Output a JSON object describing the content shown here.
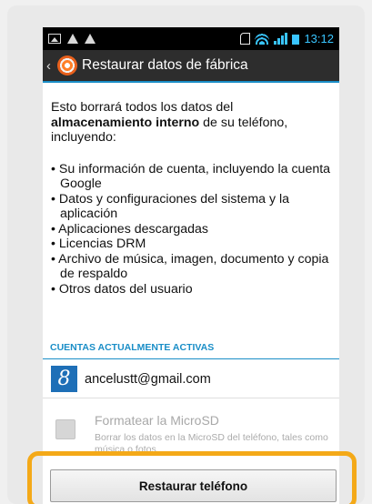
{
  "status_bar": {
    "time": "13:12"
  },
  "action_bar": {
    "title": "Restaurar datos de fábrica"
  },
  "warning": {
    "intro_prefix": "Esto borrará todos los datos del ",
    "intro_bold": "almacenamiento interno",
    "intro_suffix": " de su teléfono, incluyendo:",
    "items": [
      "Su información de cuenta, incluyendo la cuenta Google",
      "Datos y configuraciones del sistema y la aplicación",
      "Aplicaciones descargadas",
      "Licencias DRM",
      "Archivo de música, imagen, documento y copia de respaldo",
      "Otros datos del usuario"
    ]
  },
  "accounts": {
    "header": "CUENTAS ACTUALMENTE ACTIVAS",
    "email": "ancelustt@gmail.com",
    "icon": "google-icon",
    "icon_glyph": "8"
  },
  "microsd": {
    "title": "Formatear la MicroSD",
    "description": "Borrar los datos en la MicroSD del teléfono, tales como música o fotos.",
    "checked": false
  },
  "reset": {
    "label": "Restaurar teléfono"
  },
  "colors": {
    "accent": "#1a8ec7",
    "highlight": "#f4a918",
    "google_blue": "#1e6fb7"
  }
}
